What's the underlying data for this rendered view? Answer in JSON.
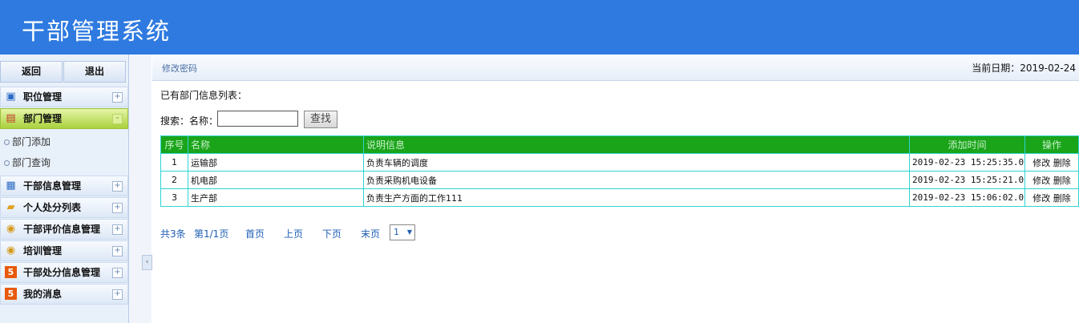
{
  "app": {
    "title": "干部管理系统"
  },
  "sidebar": {
    "top_buttons": {
      "back": "返回",
      "logout": "退出"
    },
    "menu": [
      {
        "label": "职位管理",
        "icon": "monitor-icon",
        "toggle": "+"
      },
      {
        "label": "部门管理",
        "icon": "table-icon",
        "toggle": "-"
      },
      {
        "label": "干部信息管理",
        "icon": "grid-icon",
        "toggle": "+"
      },
      {
        "label": "个人处分列表",
        "icon": "folder-icon",
        "toggle": "+"
      },
      {
        "label": "干部评价信息管理",
        "icon": "badge-icon",
        "toggle": "+"
      },
      {
        "label": "培训管理",
        "icon": "badge-icon",
        "toggle": "+"
      },
      {
        "label": "干部处分信息管理",
        "icon": "html5-icon",
        "toggle": "+"
      },
      {
        "label": "我的消息",
        "icon": "html5-icon",
        "toggle": "+"
      }
    ],
    "submenu": [
      {
        "label": "部门添加"
      },
      {
        "label": "部门查询"
      }
    ],
    "collapse_glyph": "‹"
  },
  "header_bar": {
    "breadcrumb": "修改密码",
    "date_label": "当前日期：2019-02-24"
  },
  "main": {
    "section_title": "已有部门信息列表：",
    "search": {
      "label": "搜索：名称：",
      "value": "",
      "button": "查找"
    },
    "table": {
      "columns": [
        "序号",
        "名称",
        "说明信息",
        "添加时间",
        "操作"
      ],
      "rows": [
        {
          "no": "1",
          "name": "运输部",
          "desc": "负责车辆的调度",
          "time": "2019-02-23 15:25:35.0",
          "edit": "修改",
          "del": "删除"
        },
        {
          "no": "2",
          "name": "机电部",
          "desc": "负责采购机电设备",
          "time": "2019-02-23 15:25:21.0",
          "edit": "修改",
          "del": "删除"
        },
        {
          "no": "3",
          "name": "生产部",
          "desc": "负责生产方面的工作111",
          "time": "2019-02-23 15:06:02.0",
          "edit": "修改",
          "del": "删除"
        }
      ]
    },
    "pager": {
      "total": "共3条",
      "page_info": "第1/1页",
      "first": "首页",
      "prev": "上页",
      "next": "下页",
      "last": "末页",
      "selected": "1"
    }
  },
  "colors": {
    "header": "#2e7ae0",
    "table_header": "#1aa41a",
    "table_border": "#2fd3d3",
    "active_menu": "#a9d13d"
  }
}
